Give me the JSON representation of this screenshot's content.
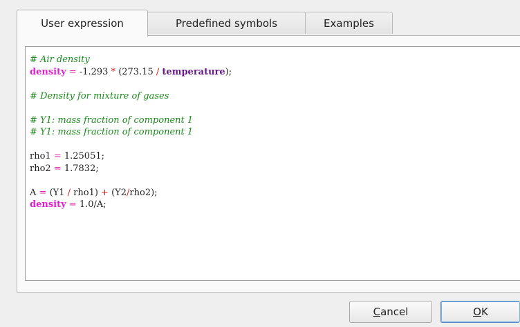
{
  "tabs": [
    {
      "label": "User expression",
      "active": true
    },
    {
      "label": "Predefined symbols",
      "active": false
    },
    {
      "label": "Examples",
      "active": false
    }
  ],
  "code": {
    "comment_air": "# Air density",
    "line_density1": {
      "lhs": "density",
      "eq": " = ",
      "num1": "-1.293",
      "op1": " * ",
      "paren_open": "(",
      "num2": "273.15",
      "op2": " / ",
      "var": "temperature",
      "tail": ");"
    },
    "comment_mix": "# Density for mixture of gases",
    "comment_y1a": "# Y1: mass fraction of component 1",
    "comment_y1b": "# Y1: mass fraction of component 1",
    "rho1": {
      "lhs": "rho1",
      "eq": " = ",
      "val": "1.25051;"
    },
    "rho2": {
      "lhs": "rho2",
      "eq": " = ",
      "val": "1.7832;"
    },
    "line_a": {
      "lhs": "A",
      "eq": " = ",
      "p1": "(Y1",
      "op1": " / ",
      "p2": "rho1)",
      "op2": " + ",
      "p3": "(Y2",
      "op3": "/",
      "p4": "rho2);"
    },
    "line_density2": {
      "lhs": "density",
      "eq": " = ",
      "val": "1.0/A;"
    }
  },
  "buttons": {
    "cancel_label": "Cancel",
    "cancel_mnemonic": "C",
    "cancel_rest": "ancel",
    "ok_label": "OK",
    "ok_mnemonic": "O",
    "ok_rest": "K"
  },
  "colors": {
    "comment": "#1a8a1a",
    "keyword": "#e020d0",
    "operator": "#d01818",
    "variable": "#6a1a8a",
    "default_button_border": "#4d88c8"
  }
}
